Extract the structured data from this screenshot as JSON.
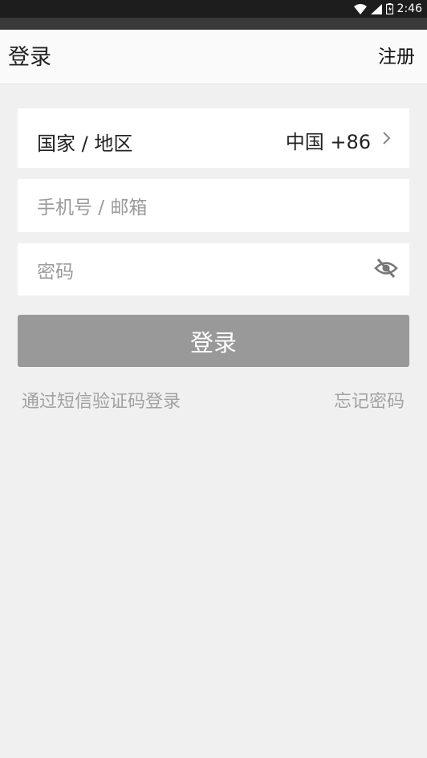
{
  "status_bar": {
    "time": "2:46"
  },
  "app_bar": {
    "title": "登录",
    "register_label": "注册"
  },
  "form": {
    "country_label": "国家 / 地区",
    "country_value": "中国 +86",
    "phone_placeholder": "手机号 / 邮箱",
    "password_placeholder": "密码",
    "login_button": "登录",
    "sms_login_link": "通过短信验证码登录",
    "forgot_password_link": "忘记密码"
  },
  "icons": {
    "chevron": "chevron-right-icon",
    "password_visibility": "eye-off-icon",
    "wifi": "wifi-icon",
    "signal": "signal-icon",
    "battery": "battery-icon"
  }
}
